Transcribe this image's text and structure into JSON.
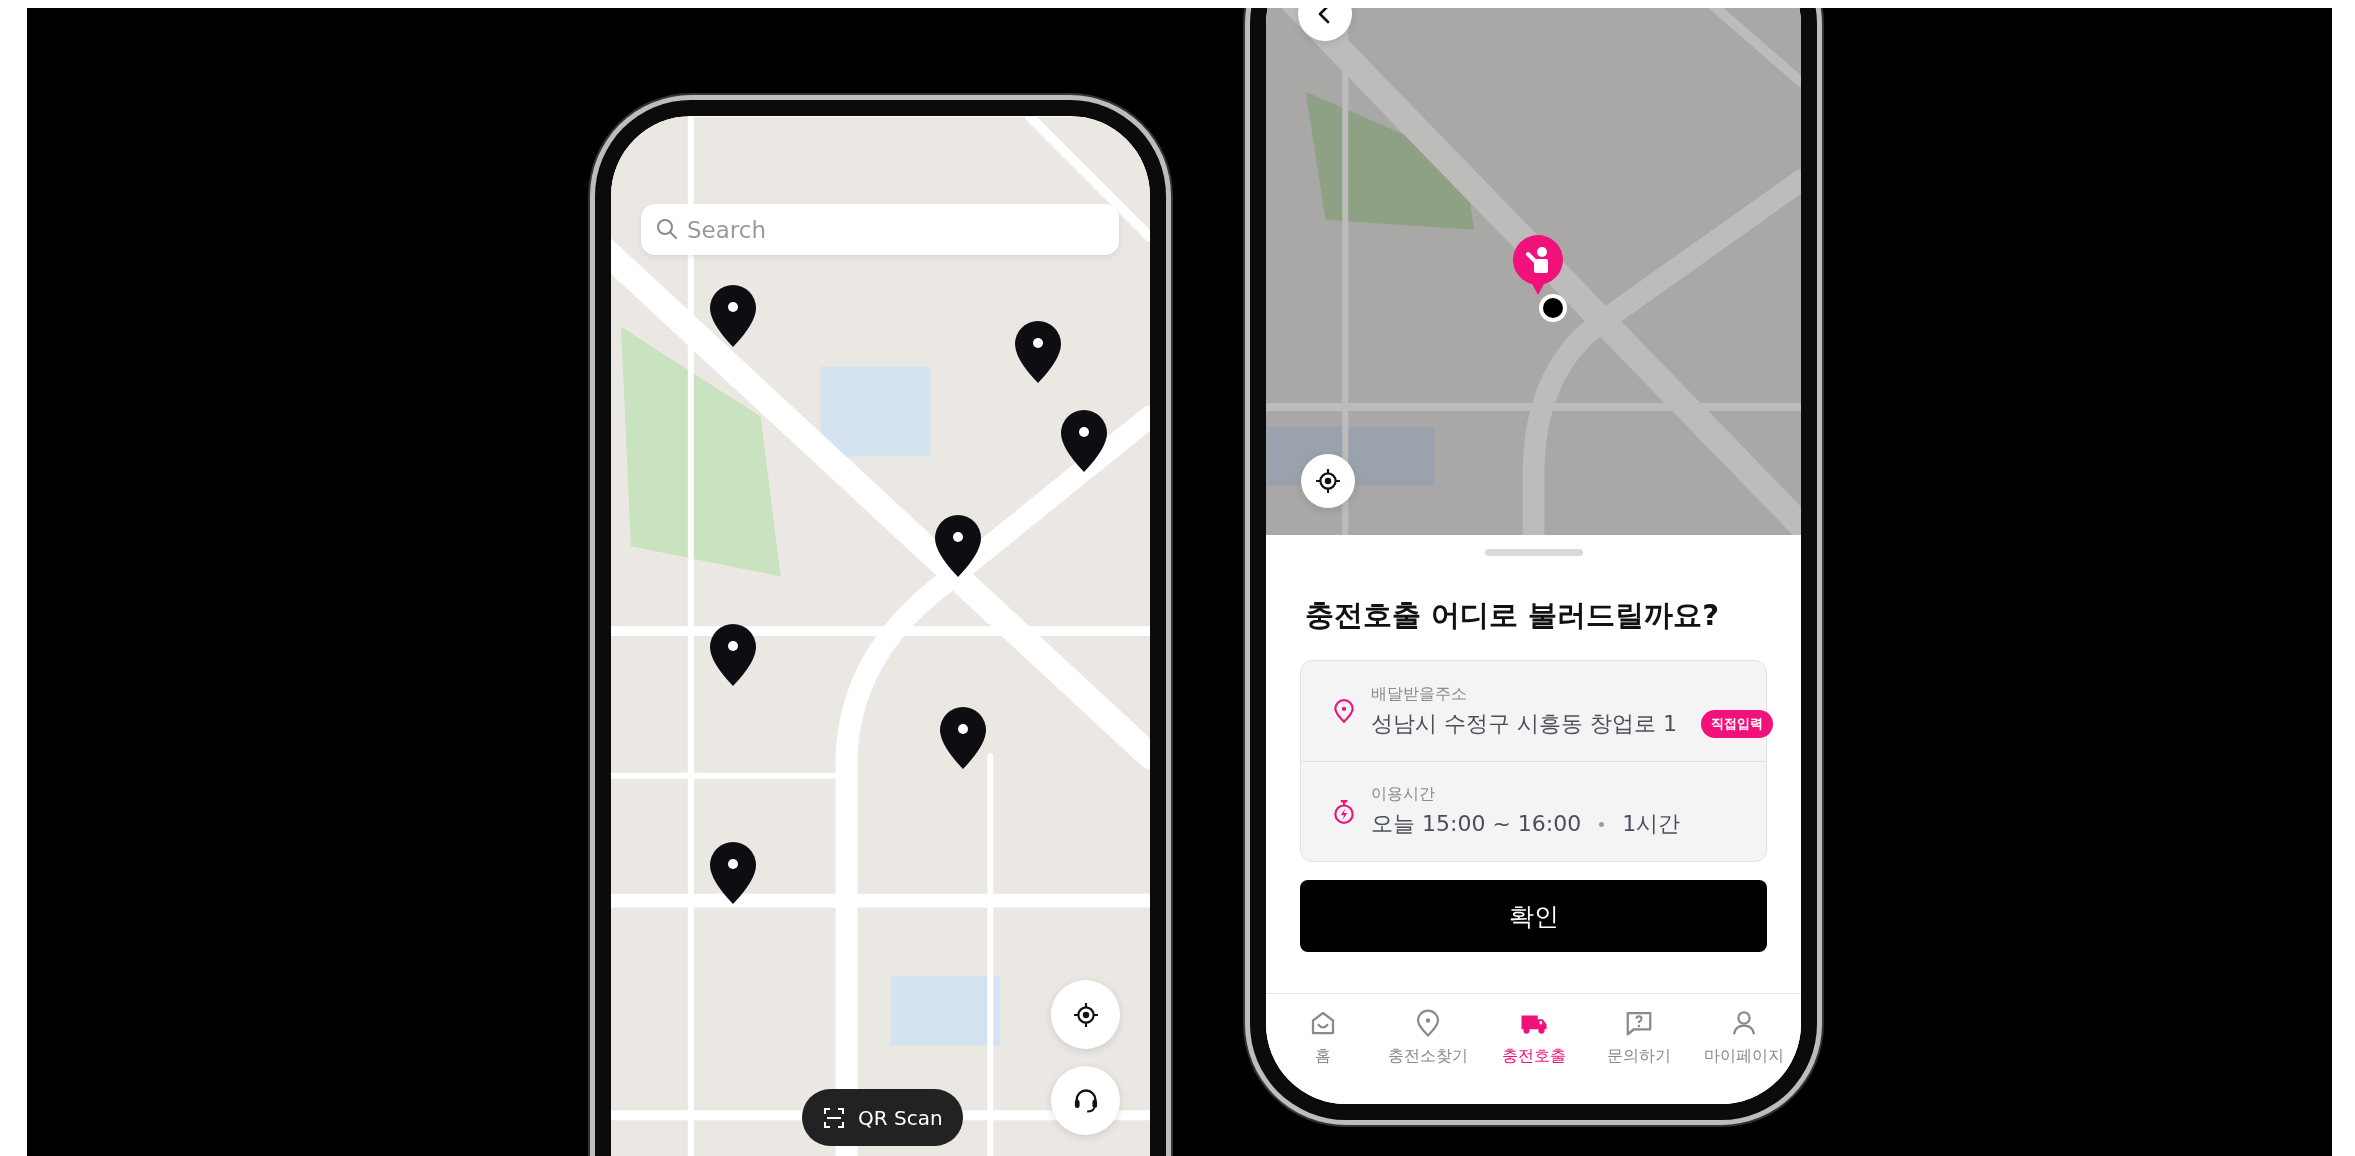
{
  "left_screen": {
    "search": {
      "placeholder": "Search"
    },
    "qr_scan_button": "QR Scan"
  },
  "right_screen": {
    "sheet": {
      "title": "충전호출 어디로 불러드릴까요?",
      "fields": [
        {
          "kind": "address",
          "label": "배달받을주소",
          "value": "성남시 수정구 시흥동 창업로 1",
          "badge": "직접입력"
        },
        {
          "kind": "time",
          "label": "이용시간",
          "value": "오늘 15:00 ~ 16:00",
          "extra": "1시간"
        }
      ],
      "confirm_button": "확인"
    },
    "tab_bar": [
      {
        "kind": "home",
        "label": "홈",
        "selected": false
      },
      {
        "kind": "station",
        "label": "충전소찾기",
        "selected": false
      },
      {
        "kind": "call",
        "label": "충전호출",
        "selected": true
      },
      {
        "kind": "inquiry",
        "label": "문의하기",
        "selected": false
      },
      {
        "kind": "mypage",
        "label": "마이페이지",
        "selected": false
      }
    ]
  }
}
